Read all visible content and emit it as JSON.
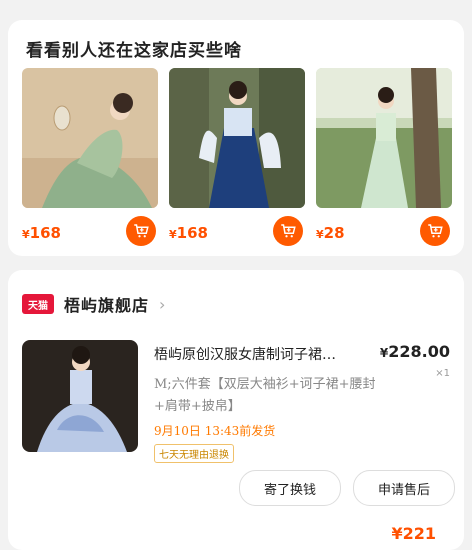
{
  "recommend": {
    "title": "看看别人还在这家店买些啥",
    "products": [
      {
        "currency": "¥",
        "price": "168"
      },
      {
        "currency": "¥",
        "price": "168"
      },
      {
        "currency": "¥",
        "price": "28"
      }
    ]
  },
  "order": {
    "badge": "天猫",
    "shop_name": "梧屿旗舰店",
    "title": "梧屿原创汉服女唐制诃子裙…",
    "currency": "¥",
    "price": "228.00",
    "qty": "×1",
    "spec": "M;六件套【双层大袖衫+诃子裙+腰封+肩带+披帛】",
    "ship": "9月10日 13:43前发货",
    "tag": "七天无理由退换",
    "buttons": {
      "return": "寄了换钱",
      "aftersale": "申请售后"
    },
    "bottom_price": "¥221"
  },
  "colors": {
    "accent": "#ff5000",
    "tmall": "#e5173a"
  }
}
